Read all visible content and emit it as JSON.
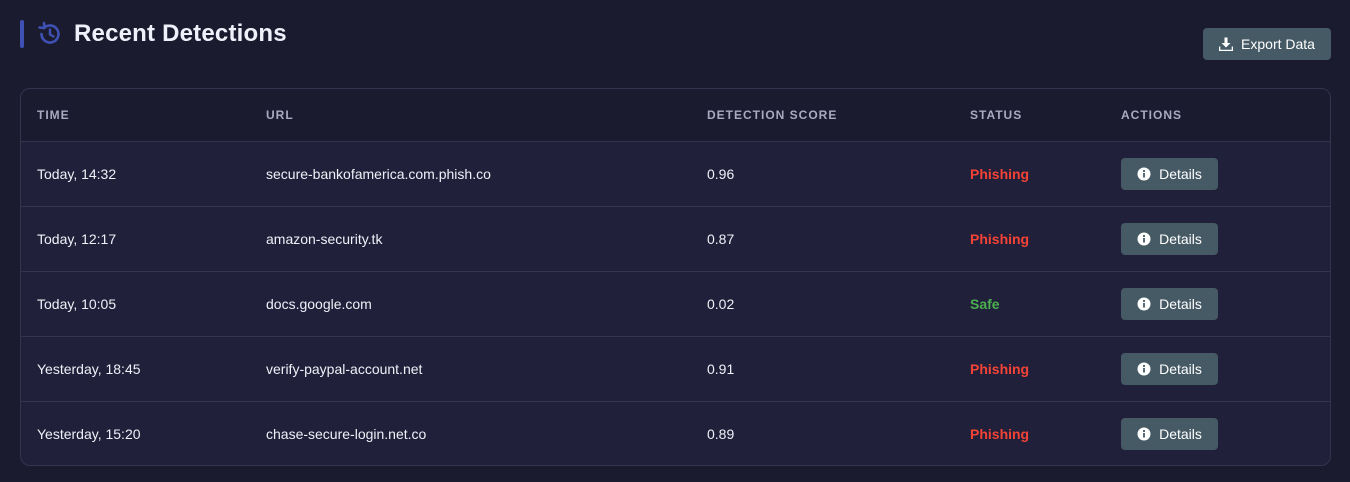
{
  "header": {
    "title": "Recent Detections",
    "title_icon": "history-icon",
    "export_label": "Export Data",
    "export_icon": "download-icon"
  },
  "table": {
    "columns": [
      "TIME",
      "URL",
      "DETECTION SCORE",
      "STATUS",
      "ACTIONS"
    ],
    "rows": [
      {
        "time": "Today, 14:32",
        "url": "secure-bankofamerica.com.phish.co",
        "score": "0.96",
        "status": "Phishing",
        "action": "Details"
      },
      {
        "time": "Today, 12:17",
        "url": "amazon-security.tk",
        "score": "0.87",
        "status": "Phishing",
        "action": "Details"
      },
      {
        "time": "Today, 10:05",
        "url": "docs.google.com",
        "score": "0.02",
        "status": "Safe",
        "action": "Details"
      },
      {
        "time": "Yesterday, 18:45",
        "url": "verify-paypal-account.net",
        "score": "0.91",
        "status": "Phishing",
        "action": "Details"
      },
      {
        "time": "Yesterday, 15:20",
        "url": "chase-secure-login.net.co",
        "score": "0.89",
        "status": "Phishing",
        "action": "Details"
      }
    ]
  },
  "colors": {
    "background": "#1b1b2f",
    "accent": "#3f51b5",
    "button": "#455a64",
    "phishing": "#f44336",
    "safe": "#4caf50"
  }
}
